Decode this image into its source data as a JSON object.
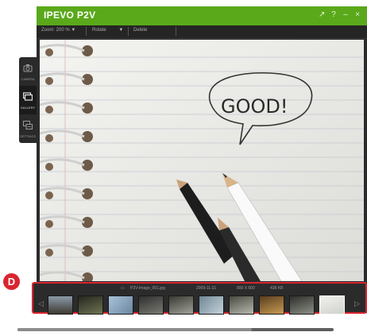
{
  "app": {
    "title": "IPEVO P2V",
    "brand_color": "#5aa91a",
    "window_controls": [
      "↗",
      "?",
      "–",
      "×"
    ]
  },
  "toolbar": {
    "zoom_label": "Zoom: 200 %",
    "rotate_label": "Rotate",
    "delete_label": "Delete"
  },
  "sidebar": {
    "items": [
      {
        "label": "CAMERA",
        "icon": "camera-icon",
        "active": false
      },
      {
        "label": "GALLERY",
        "icon": "gallery-icon",
        "active": true
      },
      {
        "label": "SETTINGS",
        "icon": "settings-icon",
        "active": false
      }
    ]
  },
  "viewer": {
    "image_text": "GOOD!"
  },
  "filmstrip": {
    "file_name": "P2V-Image_001.jpg",
    "date": "2009-11-21",
    "resolution": "800 X 600",
    "size": "438 KB",
    "highlight_color": "#d9252e",
    "thumbnail_count": 10,
    "selected_index": 9
  },
  "callout": {
    "label": "D"
  }
}
